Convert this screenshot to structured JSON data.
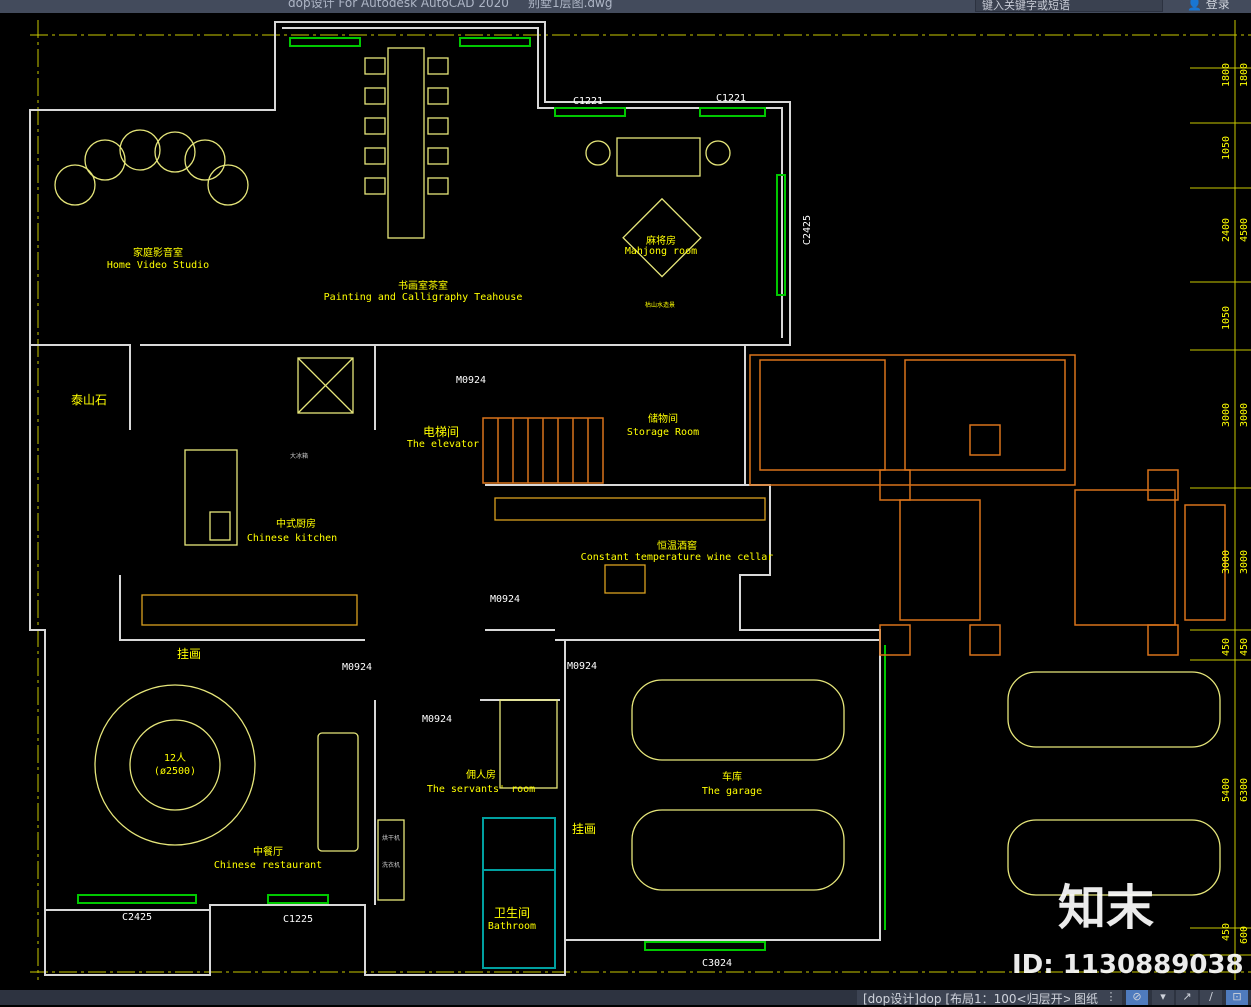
{
  "window": {
    "title": "dop设计 For Autodesk AutoCAD 2020     别墅1层图.dwg",
    "search_placeholder": "键入关键字或短语",
    "login_label": "登录"
  },
  "rooms": [
    {
      "cn": "家庭影音室",
      "en": "Home Video Studio"
    },
    {
      "cn": "书画室茶室",
      "en": "Painting and Calligraphy Teahouse"
    },
    {
      "cn": "麻将房",
      "en": "Mahjong room"
    },
    {
      "cn": "电梯间",
      "en": "The elevator"
    },
    {
      "cn": "储物间",
      "en": "Storage Room"
    },
    {
      "cn": "中式厨房",
      "en": "Chinese kitchen"
    },
    {
      "cn": "恒温酒窖",
      "en": "Constant temperature wine cellar"
    },
    {
      "cn": "中餐厅",
      "en": "Chinese restaurant"
    },
    {
      "cn": "佣人房",
      "en": "The servants' room"
    },
    {
      "cn": "车库",
      "en": "The garage"
    },
    {
      "cn": "卫生间",
      "en": "Bathroom"
    }
  ],
  "annotations": {
    "taishan_stone": "泰山石",
    "painting_1": "挂画",
    "painting_2": "挂画",
    "table_people": "12人",
    "table_size": "(ø2500)",
    "landscape": "枯山水造景",
    "fridge": "大冰箱",
    "dryer": "烘干机",
    "washer": "洗衣机"
  },
  "doors": [
    "M0924",
    "M0924",
    "M0924",
    "M0924",
    "M0924"
  ],
  "windows": [
    "C1221",
    "C1221",
    "C2425",
    "C2425",
    "C1225",
    "C3024"
  ],
  "dimensions": {
    "inner": [
      "1800",
      "1050",
      "2400",
      "1050",
      "3000",
      "3000",
      "450",
      "5400",
      "450"
    ],
    "outer": [
      "1800",
      "4500",
      "3000",
      "3000",
      "450",
      "6300",
      "600"
    ]
  },
  "watermark": {
    "logo": "知末",
    "id": "ID: 1130889038"
  },
  "status": {
    "layout_label": "[dop设计]dop [布局1：100<归层开>",
    "paper_label": "图纸"
  },
  "colors": {
    "wall": "#d8d8d8",
    "label": "#ffff00",
    "furniture": "#e6e67a",
    "stair": "#d9731a",
    "window": "#00c800",
    "dim": "#c8c800"
  }
}
